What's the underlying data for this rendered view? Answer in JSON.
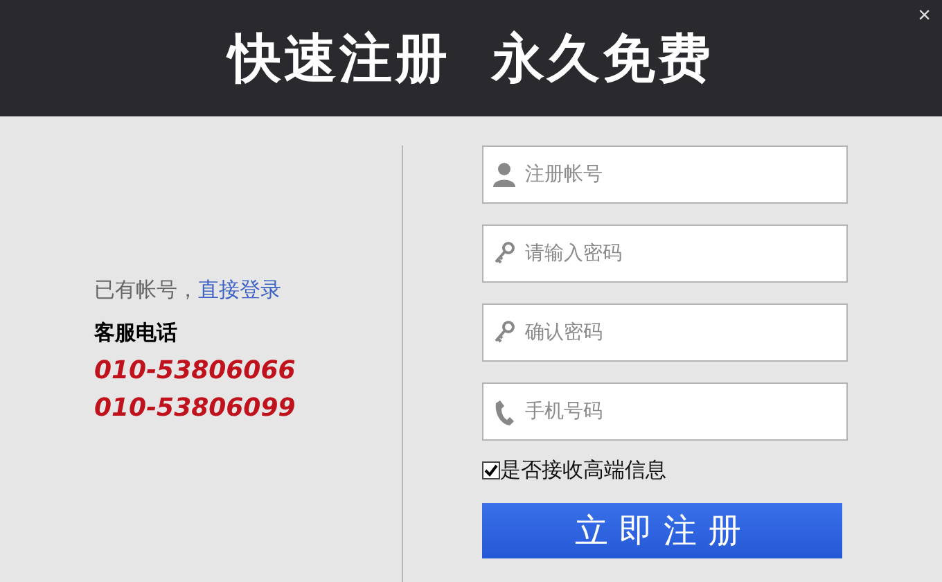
{
  "header": {
    "title": "快速注册  永久免费",
    "close": "×"
  },
  "login_prompt": {
    "text": "已有帐号，",
    "link": "直接登录"
  },
  "service": {
    "label": "客服电话",
    "phones": [
      "010-53806066",
      "010-53806099"
    ]
  },
  "fields": [
    {
      "kind": "user",
      "placeholder": "注册帐号"
    },
    {
      "kind": "key",
      "placeholder": "请输入密码"
    },
    {
      "kind": "key",
      "placeholder": "确认密码"
    },
    {
      "kind": "phone",
      "placeholder": "手机号码"
    }
  ],
  "consent": {
    "label": "是否接收高端信息",
    "checked": true
  },
  "submit": "立即注册"
}
